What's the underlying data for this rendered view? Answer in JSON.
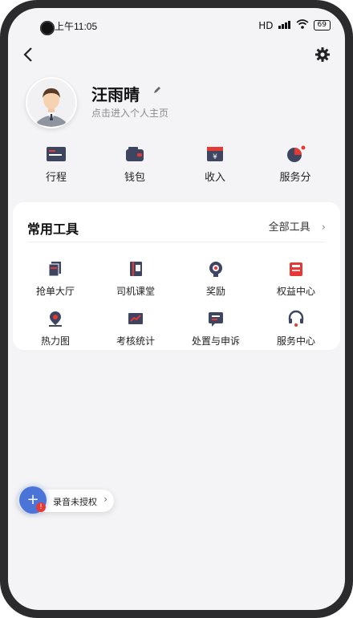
{
  "status_bar": {
    "time": "上午11:05",
    "signal": "HD",
    "battery": "69"
  },
  "header": {
    "back_icon": "back-chevron-icon",
    "settings_icon": "gear-icon"
  },
  "profile": {
    "name": "汪雨晴",
    "subtitle": "点击进入个人主页"
  },
  "quick_actions": [
    {
      "label": "行程",
      "icon": "trip-card-icon"
    },
    {
      "label": "钱包",
      "icon": "wallet-icon"
    },
    {
      "label": "收入",
      "icon": "income-icon"
    },
    {
      "label": "服务分",
      "icon": "score-pie-icon"
    }
  ],
  "tools": {
    "title": "常用工具",
    "all_label": "全部工具",
    "items": [
      {
        "label": "抢单大厅",
        "icon": "orders-hall-icon"
      },
      {
        "label": "司机课堂",
        "icon": "classroom-book-icon"
      },
      {
        "label": "奖励",
        "icon": "reward-medal-icon"
      },
      {
        "label": "权益中心",
        "icon": "benefits-gift-icon"
      },
      {
        "label": "热力图",
        "icon": "heatmap-pin-icon"
      },
      {
        "label": "考核统计",
        "icon": "stats-chart-icon"
      },
      {
        "label": "处置与申诉",
        "icon": "appeal-message-icon"
      },
      {
        "label": "服务中心",
        "icon": "headset-icon"
      }
    ]
  },
  "recording": {
    "label": "录音未授权",
    "badge": "!"
  },
  "colors": {
    "accent_blue": "#4a74d8",
    "icon_dark": "#3d4560",
    "icon_red": "#e53935"
  }
}
